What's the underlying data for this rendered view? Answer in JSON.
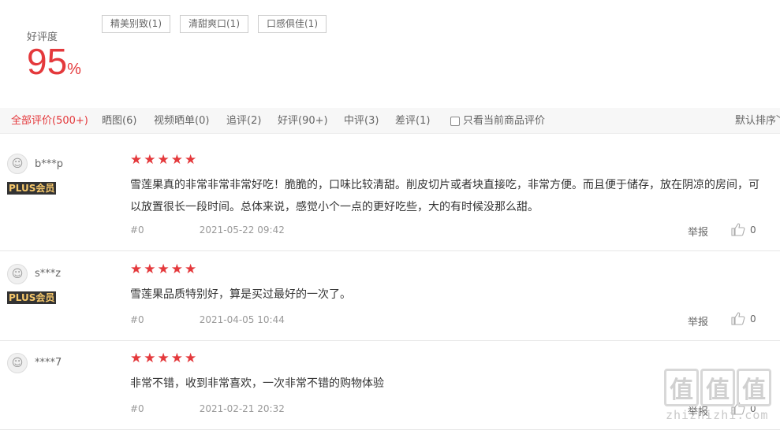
{
  "summary": {
    "rate_label": "好评度",
    "rate_value": "95",
    "rate_unit": "%",
    "tags": [
      "精美别致(1)",
      "清甜爽口(1)",
      "口感俱佳(1)"
    ]
  },
  "tabs": [
    {
      "label": "全部评价(500+)",
      "active": true
    },
    {
      "label": "晒图(6)",
      "active": false
    },
    {
      "label": "视频晒单(0)",
      "active": false
    },
    {
      "label": "追评(2)",
      "active": false
    },
    {
      "label": "好评(90+)",
      "active": false
    },
    {
      "label": "中评(3)",
      "active": false
    },
    {
      "label": "差评(1)",
      "active": false
    }
  ],
  "filter_label": "只看当前商品评价",
  "sort_label": "默认排序",
  "reviews": [
    {
      "user": "b***p",
      "badge": "PLUS会员",
      "stars": 5,
      "content": "雪莲果真的非常非常非常好吃！脆脆的，口味比较清甜。削皮切片或者块直接吃，非常方便。而且便于储存，放在阴凉的房间，可\n以放置很长一段时间。总体来说，感觉小个一点的更好吃些，大的有时候没那么甜。",
      "index": "#0",
      "date": "2021-05-22 09:42",
      "report": "举报",
      "likes": "0"
    },
    {
      "user": "s***z",
      "badge": "PLUS会员",
      "stars": 5,
      "content": "雪莲果品质特别好，算是买过最好的一次了。",
      "index": "#0",
      "date": "2021-04-05 10:44",
      "report": "举报",
      "likes": "0"
    },
    {
      "user": "****7",
      "badge": "",
      "stars": 5,
      "content": "非常不错，收到非常喜欢，一次非常不错的购物体验",
      "index": "#0",
      "date": "2021-02-21 20:32",
      "report": "举报",
      "likes": "0"
    }
  ],
  "watermark": {
    "glyph": "值",
    "url": "zhizhizhi.com"
  },
  "colors": {
    "accent": "#e4393c",
    "plus_bg": "#333333",
    "plus_fg": "#f5c76b"
  }
}
